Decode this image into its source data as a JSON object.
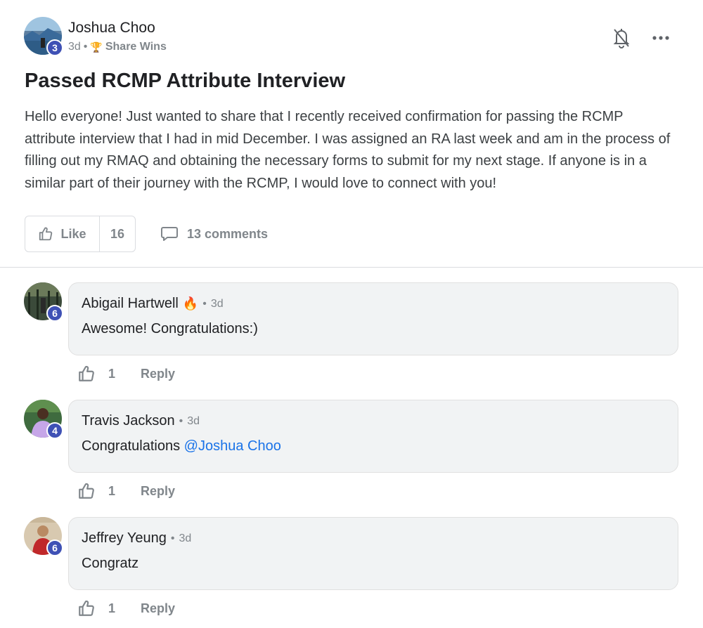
{
  "post": {
    "author": {
      "name": "Joshua Choo",
      "level": "3",
      "time": "3d",
      "separator": "•",
      "category_icon": "trophy-icon",
      "category": "Share Wins"
    },
    "title": "Passed RCMP Attribute Interview",
    "body": "Hello everyone! Just wanted to share that I recently received confirmation for passing the RCMP attribute interview that I had in mid December. I was assigned an RA last week and am in the process of filling out my RMAQ and obtaining the necessary forms to submit for my next stage. If anyone is in a similar part of their journey with the RCMP, I would love to connect with you!",
    "like_label": "Like",
    "like_count": "16",
    "comments_label": "13 comments",
    "header_icons": [
      "bell-off-icon",
      "more-horizontal-icon"
    ]
  },
  "comments": [
    {
      "name": "Abigail Hartwell",
      "flair": "🔥",
      "time": "3d",
      "level": "6",
      "text": "Awesome! Congratulations:)",
      "mention": "",
      "likes": "1",
      "reply_label": "Reply"
    },
    {
      "name": "Travis Jackson",
      "flair": "",
      "time": "3d",
      "level": "4",
      "text": "Congratulations ",
      "mention": "@Joshua Choo",
      "likes": "1",
      "reply_label": "Reply"
    },
    {
      "name": "Jeffrey Yeung",
      "flair": "",
      "time": "3d",
      "level": "6",
      "text": "Congratz",
      "mention": "",
      "likes": "1",
      "reply_label": "Reply"
    }
  ],
  "colors": {
    "accent": "#3f51b5",
    "mention": "#1a73e8",
    "muted": "#80868b",
    "bubble": "#f1f3f4"
  }
}
